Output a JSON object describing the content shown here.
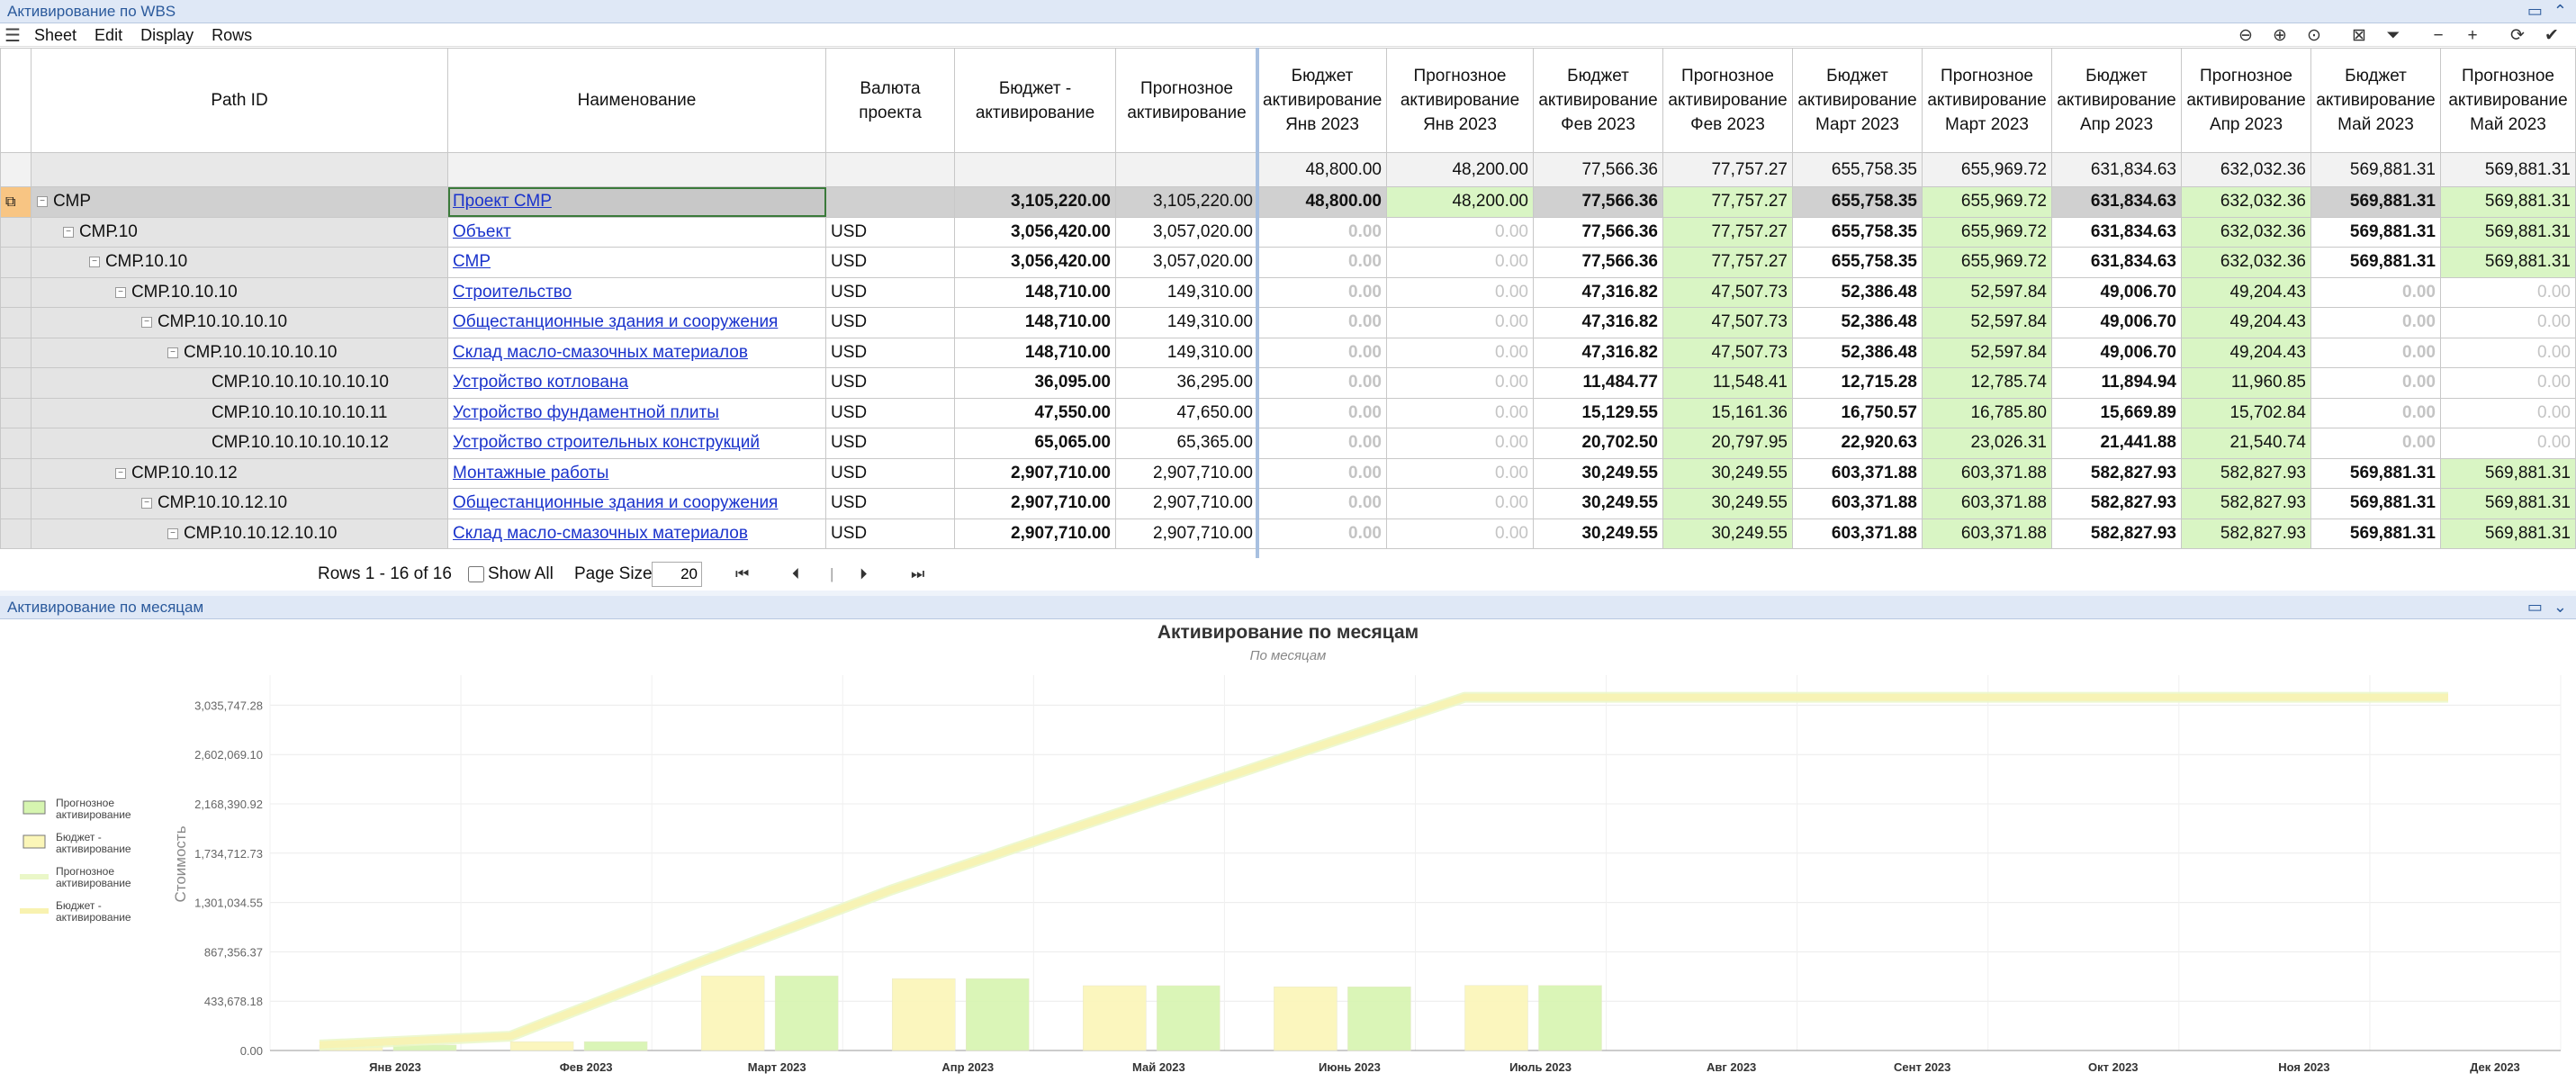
{
  "top_panel": {
    "title": "Активирование по WBS"
  },
  "menu": [
    "Sheet",
    "Edit",
    "Display",
    "Rows"
  ],
  "toolbar_icons": [
    "zoom-out-icon",
    "zoom-in-icon",
    "zoom-reset-icon",
    "clear-filter-icon",
    "filter-icon",
    "collapse-icon",
    "expand-icon",
    "refresh-icon",
    "check-icon"
  ],
  "columns": [
    "Path ID",
    "Наименование",
    "Валюта проекта",
    "Бюджет - активирование",
    "Прогнозное активирование",
    "Бюджет активирование Янв 2023",
    "Прогнозное активирование Янв 2023",
    "Бюджет активирование Фев 2023",
    "Прогнозное активирование Фев 2023",
    "Бюджет активирование Март 2023",
    "Прогнозное активирование Март 2023",
    "Бюджет активирование Апр 2023",
    "Прогнозное активирование Апр 2023",
    "Бюджет активирование Май 2023",
    "Прогнозное активирование Май 2023"
  ],
  "summary_row": [
    "",
    "",
    "",
    "",
    "",
    "48,800.00",
    "48,200.00",
    "77,566.36",
    "77,757.27",
    "655,758.35",
    "655,969.72",
    "631,834.63",
    "632,032.36",
    "569,881.31",
    "569,881.31"
  ],
  "rows": [
    {
      "pid": "СМР",
      "level": 0,
      "name": "Проект СМР",
      "cur": "",
      "values": [
        "3,105,220.00",
        "3,105,220.00",
        "48,800.00",
        "48,200.00",
        "77,566.36",
        "77,757.27",
        "655,758.35",
        "655,969.72",
        "631,834.63",
        "632,032.36",
        "569,881.31",
        "569,881.31"
      ]
    },
    {
      "pid": "СМР.10",
      "level": 1,
      "name": "Объект",
      "cur": "USD",
      "values": [
        "3,056,420.00",
        "3,057,020.00",
        "0.00",
        "0.00",
        "77,566.36",
        "77,757.27",
        "655,758.35",
        "655,969.72",
        "631,834.63",
        "632,032.36",
        "569,881.31",
        "569,881.31"
      ]
    },
    {
      "pid": "СМР.10.10",
      "level": 2,
      "name": "СМР",
      "cur": "USD",
      "values": [
        "3,056,420.00",
        "3,057,020.00",
        "0.00",
        "0.00",
        "77,566.36",
        "77,757.27",
        "655,758.35",
        "655,969.72",
        "631,834.63",
        "632,032.36",
        "569,881.31",
        "569,881.31"
      ]
    },
    {
      "pid": "СМР.10.10.10",
      "level": 3,
      "name": "Строительство",
      "cur": "USD",
      "values": [
        "148,710.00",
        "149,310.00",
        "0.00",
        "0.00",
        "47,316.82",
        "47,507.73",
        "52,386.48",
        "52,597.84",
        "49,006.70",
        "49,204.43",
        "0.00",
        "0.00"
      ]
    },
    {
      "pid": "СМР.10.10.10.10",
      "level": 4,
      "name": "Общестанционные здания и сооружения",
      "cur": "USD",
      "values": [
        "148,710.00",
        "149,310.00",
        "0.00",
        "0.00",
        "47,316.82",
        "47,507.73",
        "52,386.48",
        "52,597.84",
        "49,006.70",
        "49,204.43",
        "0.00",
        "0.00"
      ]
    },
    {
      "pid": "СМР.10.10.10.10.10",
      "level": 5,
      "name": "Склад масло-смазочных материалов",
      "cur": "USD",
      "values": [
        "148,710.00",
        "149,310.00",
        "0.00",
        "0.00",
        "47,316.82",
        "47,507.73",
        "52,386.48",
        "52,597.84",
        "49,006.70",
        "49,204.43",
        "0.00",
        "0.00"
      ]
    },
    {
      "pid": "СМР.10.10.10.10.10.10",
      "level": 6,
      "name": "Устройство котлована",
      "cur": "USD",
      "values": [
        "36,095.00",
        "36,295.00",
        "0.00",
        "0.00",
        "11,484.77",
        "11,548.41",
        "12,715.28",
        "12,785.74",
        "11,894.94",
        "11,960.85",
        "0.00",
        "0.00"
      ]
    },
    {
      "pid": "СМР.10.10.10.10.10.11",
      "level": 6,
      "name": "Устройство фундаментной плиты",
      "cur": "USD",
      "values": [
        "47,550.00",
        "47,650.00",
        "0.00",
        "0.00",
        "15,129.55",
        "15,161.36",
        "16,750.57",
        "16,785.80",
        "15,669.89",
        "15,702.84",
        "0.00",
        "0.00"
      ]
    },
    {
      "pid": "СМР.10.10.10.10.10.12",
      "level": 6,
      "name": "Устройство строительных конструкций",
      "cur": "USD",
      "values": [
        "65,065.00",
        "65,365.00",
        "0.00",
        "0.00",
        "20,702.50",
        "20,797.95",
        "22,920.63",
        "23,026.31",
        "21,441.88",
        "21,540.74",
        "0.00",
        "0.00"
      ]
    },
    {
      "pid": "СМР.10.10.12",
      "level": 3,
      "name": "Монтажные работы",
      "cur": "USD",
      "values": [
        "2,907,710.00",
        "2,907,710.00",
        "0.00",
        "0.00",
        "30,249.55",
        "30,249.55",
        "603,371.88",
        "603,371.88",
        "582,827.93",
        "582,827.93",
        "569,881.31",
        "569,881.31"
      ]
    },
    {
      "pid": "СМР.10.10.12.10",
      "level": 4,
      "name": "Общестанционные здания и сооружения",
      "cur": "USD",
      "values": [
        "2,907,710.00",
        "2,907,710.00",
        "0.00",
        "0.00",
        "30,249.55",
        "30,249.55",
        "603,371.88",
        "603,371.88",
        "582,827.93",
        "582,827.93",
        "569,881.31",
        "569,881.31"
      ]
    },
    {
      "pid": "СМР.10.10.12.10.10",
      "level": 5,
      "name": "Склад масло-смазочных материалов",
      "cur": "USD",
      "values": [
        "2,907,710.00",
        "2,907,710.00",
        "0.00",
        "0.00",
        "30,249.55",
        "30,249.55",
        "603,371.88",
        "603,371.88",
        "582,827.93",
        "582,827.93",
        "569,881.31",
        "569,881.31"
      ]
    }
  ],
  "pager": {
    "rows_text": "Rows 1 - 16 of 16",
    "show_all": "Show All",
    "page_size_label": "Page Size",
    "page_size": "20"
  },
  "bottom_panel": {
    "title": "Активирование по месяцам"
  },
  "chart_data": {
    "type": "bar",
    "title": "Активирование по месяцам",
    "subtitle": "По месяцам",
    "ylabel": "Стоимость",
    "xlabel": "",
    "categories": [
      "Янв 2023",
      "Фев 2023",
      "Март 2023",
      "Апр 2023",
      "Май 2023",
      "Июнь 2023",
      "Июль 2023",
      "Авг 2023",
      "Сент 2023",
      "Окт 2023",
      "Ноя 2023",
      "Дек 2023"
    ],
    "yticks": [
      "3,035,747.28",
      "2,602,069.10",
      "2,168,390.92",
      "1,734,712.73",
      "1,301,034.55",
      "867,356.37",
      "433,678.18",
      "0.00"
    ],
    "ylim": [
      0,
      3300000
    ],
    "grid": true,
    "legend_placement": "left",
    "series": [
      {
        "name": "Прогнозное активирование",
        "kind": "bar",
        "color": "#d6f5b0",
        "values": [
          48200,
          77757.27,
          655969.72,
          632032.36,
          569881.31,
          560000,
          572000,
          0,
          0,
          0,
          0,
          0
        ]
      },
      {
        "name": "Бюджет - активирование",
        "kind": "bar",
        "color": "#fbf6b8",
        "values": [
          48800,
          77566.36,
          655758.35,
          631834.63,
          569881.31,
          560000,
          572000,
          0,
          0,
          0,
          0,
          0
        ]
      },
      {
        "name": "Прогнозное активирование",
        "kind": "line",
        "color": "#eaf7c8",
        "values": [
          48200,
          125957,
          781927,
          1413959,
          1983840,
          2543840,
          3105220,
          3105220,
          3105220,
          3105220,
          3105220,
          3105220
        ]
      },
      {
        "name": "Бюджет - активирование",
        "kind": "line",
        "color": "#f8f2b0",
        "values": [
          48800,
          126366,
          782125,
          1413959,
          1983840,
          2543840,
          3105220,
          3105220,
          3105220,
          3105220,
          3105220,
          3105220
        ]
      }
    ]
  },
  "colors": {
    "path_header": "#f8c583",
    "forecast_cell": "#d9f5c4",
    "title_bar": "#dfe8f6",
    "link": "#1a33cc"
  }
}
